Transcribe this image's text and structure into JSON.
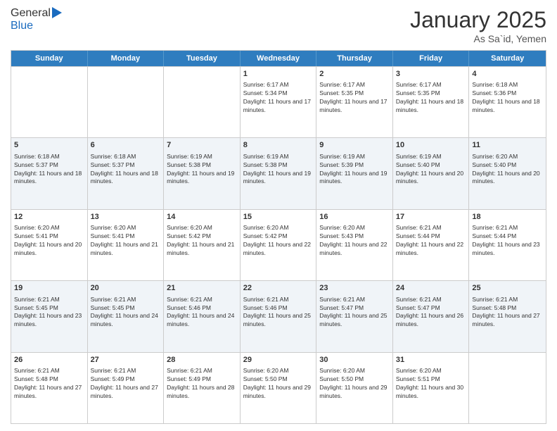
{
  "header": {
    "logo_general": "General",
    "logo_blue": "Blue",
    "month_title": "January 2025",
    "location": "As Sa`id, Yemen"
  },
  "weekdays": [
    "Sunday",
    "Monday",
    "Tuesday",
    "Wednesday",
    "Thursday",
    "Friday",
    "Saturday"
  ],
  "rows": [
    {
      "alt": false,
      "cells": [
        {
          "day": "",
          "info": ""
        },
        {
          "day": "",
          "info": ""
        },
        {
          "day": "",
          "info": ""
        },
        {
          "day": "1",
          "info": "Sunrise: 6:17 AM\nSunset: 5:34 PM\nDaylight: 11 hours and 17 minutes."
        },
        {
          "day": "2",
          "info": "Sunrise: 6:17 AM\nSunset: 5:35 PM\nDaylight: 11 hours and 17 minutes."
        },
        {
          "day": "3",
          "info": "Sunrise: 6:17 AM\nSunset: 5:35 PM\nDaylight: 11 hours and 18 minutes."
        },
        {
          "day": "4",
          "info": "Sunrise: 6:18 AM\nSunset: 5:36 PM\nDaylight: 11 hours and 18 minutes."
        }
      ]
    },
    {
      "alt": true,
      "cells": [
        {
          "day": "5",
          "info": "Sunrise: 6:18 AM\nSunset: 5:37 PM\nDaylight: 11 hours and 18 minutes."
        },
        {
          "day": "6",
          "info": "Sunrise: 6:18 AM\nSunset: 5:37 PM\nDaylight: 11 hours and 18 minutes."
        },
        {
          "day": "7",
          "info": "Sunrise: 6:19 AM\nSunset: 5:38 PM\nDaylight: 11 hours and 19 minutes."
        },
        {
          "day": "8",
          "info": "Sunrise: 6:19 AM\nSunset: 5:38 PM\nDaylight: 11 hours and 19 minutes."
        },
        {
          "day": "9",
          "info": "Sunrise: 6:19 AM\nSunset: 5:39 PM\nDaylight: 11 hours and 19 minutes."
        },
        {
          "day": "10",
          "info": "Sunrise: 6:19 AM\nSunset: 5:40 PM\nDaylight: 11 hours and 20 minutes."
        },
        {
          "day": "11",
          "info": "Sunrise: 6:20 AM\nSunset: 5:40 PM\nDaylight: 11 hours and 20 minutes."
        }
      ]
    },
    {
      "alt": false,
      "cells": [
        {
          "day": "12",
          "info": "Sunrise: 6:20 AM\nSunset: 5:41 PM\nDaylight: 11 hours and 20 minutes."
        },
        {
          "day": "13",
          "info": "Sunrise: 6:20 AM\nSunset: 5:41 PM\nDaylight: 11 hours and 21 minutes."
        },
        {
          "day": "14",
          "info": "Sunrise: 6:20 AM\nSunset: 5:42 PM\nDaylight: 11 hours and 21 minutes."
        },
        {
          "day": "15",
          "info": "Sunrise: 6:20 AM\nSunset: 5:42 PM\nDaylight: 11 hours and 22 minutes."
        },
        {
          "day": "16",
          "info": "Sunrise: 6:20 AM\nSunset: 5:43 PM\nDaylight: 11 hours and 22 minutes."
        },
        {
          "day": "17",
          "info": "Sunrise: 6:21 AM\nSunset: 5:44 PM\nDaylight: 11 hours and 22 minutes."
        },
        {
          "day": "18",
          "info": "Sunrise: 6:21 AM\nSunset: 5:44 PM\nDaylight: 11 hours and 23 minutes."
        }
      ]
    },
    {
      "alt": true,
      "cells": [
        {
          "day": "19",
          "info": "Sunrise: 6:21 AM\nSunset: 5:45 PM\nDaylight: 11 hours and 23 minutes."
        },
        {
          "day": "20",
          "info": "Sunrise: 6:21 AM\nSunset: 5:45 PM\nDaylight: 11 hours and 24 minutes."
        },
        {
          "day": "21",
          "info": "Sunrise: 6:21 AM\nSunset: 5:46 PM\nDaylight: 11 hours and 24 minutes."
        },
        {
          "day": "22",
          "info": "Sunrise: 6:21 AM\nSunset: 5:46 PM\nDaylight: 11 hours and 25 minutes."
        },
        {
          "day": "23",
          "info": "Sunrise: 6:21 AM\nSunset: 5:47 PM\nDaylight: 11 hours and 25 minutes."
        },
        {
          "day": "24",
          "info": "Sunrise: 6:21 AM\nSunset: 5:47 PM\nDaylight: 11 hours and 26 minutes."
        },
        {
          "day": "25",
          "info": "Sunrise: 6:21 AM\nSunset: 5:48 PM\nDaylight: 11 hours and 27 minutes."
        }
      ]
    },
    {
      "alt": false,
      "cells": [
        {
          "day": "26",
          "info": "Sunrise: 6:21 AM\nSunset: 5:48 PM\nDaylight: 11 hours and 27 minutes."
        },
        {
          "day": "27",
          "info": "Sunrise: 6:21 AM\nSunset: 5:49 PM\nDaylight: 11 hours and 27 minutes."
        },
        {
          "day": "28",
          "info": "Sunrise: 6:21 AM\nSunset: 5:49 PM\nDaylight: 11 hours and 28 minutes."
        },
        {
          "day": "29",
          "info": "Sunrise: 6:20 AM\nSunset: 5:50 PM\nDaylight: 11 hours and 29 minutes."
        },
        {
          "day": "30",
          "info": "Sunrise: 6:20 AM\nSunset: 5:50 PM\nDaylight: 11 hours and 29 minutes."
        },
        {
          "day": "31",
          "info": "Sunrise: 6:20 AM\nSunset: 5:51 PM\nDaylight: 11 hours and 30 minutes."
        },
        {
          "day": "",
          "info": ""
        }
      ]
    }
  ]
}
